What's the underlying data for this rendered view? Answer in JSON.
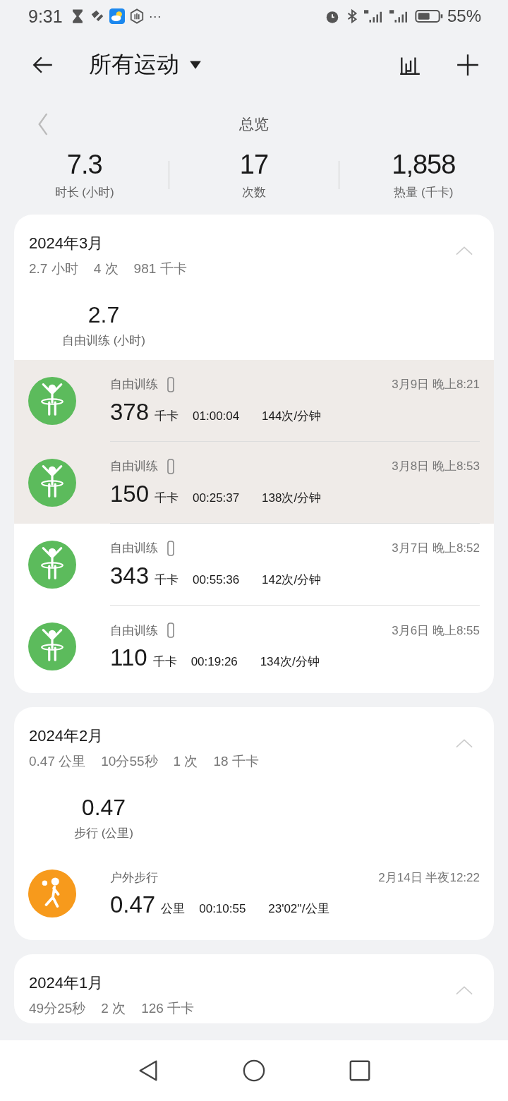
{
  "status_bar": {
    "time": "9:31",
    "more": "···",
    "battery": "55%"
  },
  "header": {
    "title": "所有运动"
  },
  "overview": {
    "title": "总览"
  },
  "totals": [
    {
      "value": "7.3",
      "label": "时长 (小时)"
    },
    {
      "value": "17",
      "label": "次数"
    },
    {
      "value": "1,858",
      "label": "热量 (千卡)"
    }
  ],
  "months": [
    {
      "title": "2024年3月",
      "expanded": true,
      "summary": [
        "2.7 小时",
        "4 次",
        "981 千卡"
      ],
      "highlight": {
        "value": "2.7",
        "label": "自由训练 (小时)"
      },
      "records": [
        {
          "kind": "training",
          "name": "自由训练",
          "device": true,
          "date": "3月9日 晚上8:21",
          "value": "378",
          "unit": "千卡",
          "duration": "01:00:04",
          "pace": "144次/分钟",
          "selected": true
        },
        {
          "kind": "training",
          "name": "自由训练",
          "device": true,
          "date": "3月8日 晚上8:53",
          "value": "150",
          "unit": "千卡",
          "duration": "00:25:37",
          "pace": "138次/分钟",
          "selected": true
        },
        {
          "kind": "training",
          "name": "自由训练",
          "device": true,
          "date": "3月7日 晚上8:52",
          "value": "343",
          "unit": "千卡",
          "duration": "00:55:36",
          "pace": "142次/分钟",
          "selected": false
        },
        {
          "kind": "training",
          "name": "自由训练",
          "device": true,
          "date": "3月6日 晚上8:55",
          "value": "110",
          "unit": "千卡",
          "duration": "00:19:26",
          "pace": "134次/分钟",
          "selected": false
        }
      ]
    },
    {
      "title": "2024年2月",
      "expanded": true,
      "summary": [
        "0.47 公里",
        "10分55秒",
        "1 次",
        "18 千卡"
      ],
      "highlight": {
        "value": "0.47",
        "label": "步行 (公里)"
      },
      "records": [
        {
          "kind": "walking",
          "name": "户外步行",
          "device": false,
          "date": "2月14日 半夜12:22",
          "value": "0.47",
          "unit": "公里",
          "duration": "00:10:55",
          "pace": "23'02''/公里",
          "selected": false
        }
      ]
    },
    {
      "title": "2024年1月",
      "expanded": true,
      "summary": [
        "49分25秒",
        "2 次",
        "126 千卡"
      ]
    }
  ]
}
